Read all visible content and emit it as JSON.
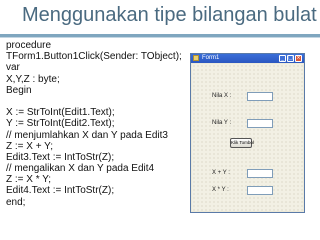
{
  "slide": {
    "title": "Menggunakan tipe bilangan bulat"
  },
  "code": {
    "lines": [
      "procedure",
      "TForm1.Button1Click(Sender: TObject);",
      "var",
      "X,Y,Z : byte;",
      "Begin",
      "",
      "X := StrToInt(Edit1.Text);",
      "Y := StrToInt(Edit2.Text);",
      "// menjumlahkan X dan Y pada Edit3",
      "Z := X + Y;",
      "Edit3.Text := IntToStr(Z);",
      "// mengalikan X dan Y pada Edit4",
      "Z := X * Y;",
      "Edit4.Text := IntToStr(Z);",
      "end;"
    ]
  },
  "window": {
    "caption": "Form1",
    "labels": {
      "x": "Nila X :",
      "y": "Nila Y :",
      "sum": "X + Y :",
      "product": "X * Y :"
    },
    "edits": {
      "edit1": "",
      "edit2": "",
      "edit3": "",
      "edit4": ""
    },
    "button_label": "Klik Tombol",
    "controls": {
      "minimize": "_",
      "maximize": "□",
      "close": "×"
    }
  }
}
